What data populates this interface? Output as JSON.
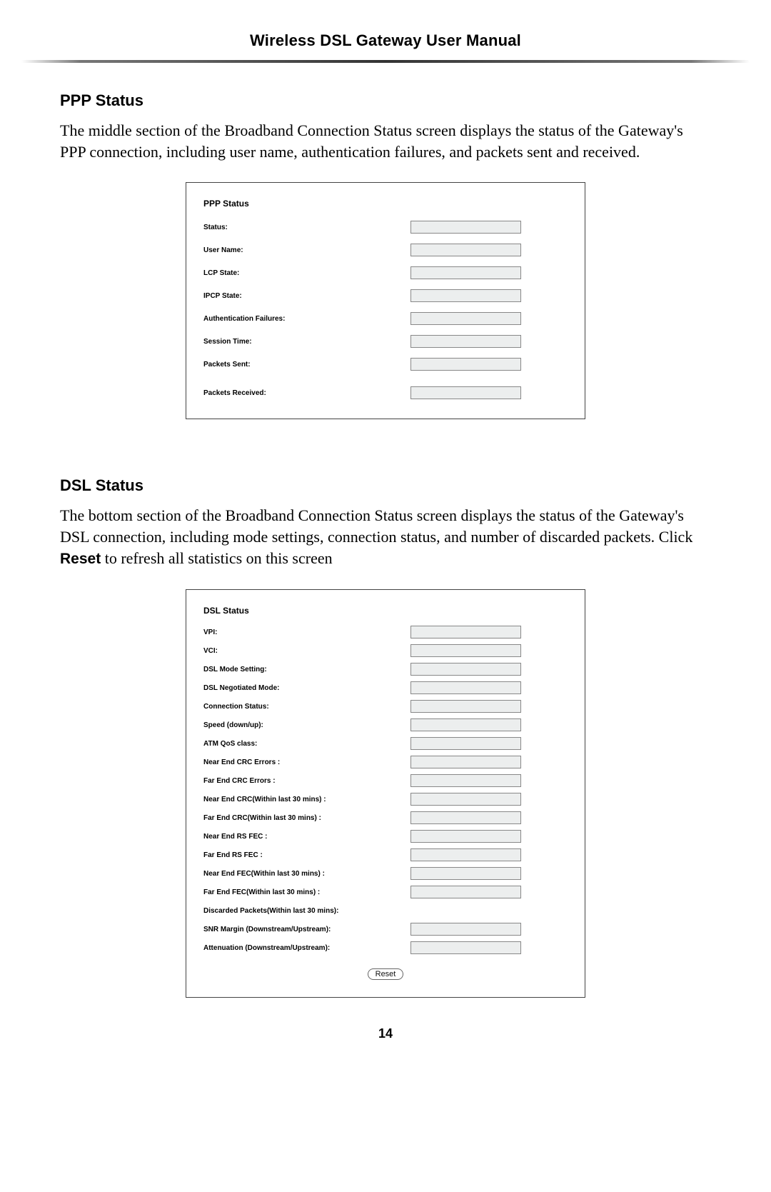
{
  "header": {
    "title": "Wireless DSL Gateway User Manual"
  },
  "ppp": {
    "section_title": "PPP Status",
    "body_text": "The middle section of the Broadband Connection Status screen displays the status of the Gateway's PPP connection, including user name, authentication failures, and packets sent and received.",
    "panel_title": "PPP Status",
    "rows": {
      "r0": "Status:",
      "r1": "User Name:",
      "r2": "LCP State:",
      "r3": "IPCP State:",
      "r4": "Authentication Failures:",
      "r5": "Session Time:",
      "r6": "Packets Sent:",
      "r7": "Packets Received:"
    }
  },
  "dsl": {
    "section_title": "DSL Status",
    "body_pre": "The bottom section of the Broadband Connection Status screen displays the status of the Gateway's DSL connection, including mode settings, connection status, and number of discarded packets. Click ",
    "body_bold": "Reset",
    "body_post": " to refresh all statistics on this screen",
    "panel_title": "DSL Status",
    "rows": {
      "r0": "VPI:",
      "r1": "VCI:",
      "r2": "DSL Mode Setting:",
      "r3": "DSL Negotiated Mode:",
      "r4": "Connection Status:",
      "r5": "Speed (down/up):",
      "r6": "ATM QoS class:",
      "r7": "Near End CRC Errors :",
      "r8": "Far End CRC Errors :",
      "r9": "Near End CRC(Within last 30 mins) :",
      "r10": "Far End CRC(Within last 30 mins) :",
      "r11": "Near End RS FEC :",
      "r12": "Far End RS FEC :",
      "r13": "Near End FEC(Within last 30 mins) :",
      "r14": "Far End FEC(Within last 30 mins) :",
      "r15": "Discarded Packets(Within last 30 mins):",
      "r16": "SNR Margin (Downstream/Upstream):",
      "r17": "Attenuation (Downstream/Upstream):"
    },
    "reset_label": "Reset"
  },
  "page_number": "14"
}
